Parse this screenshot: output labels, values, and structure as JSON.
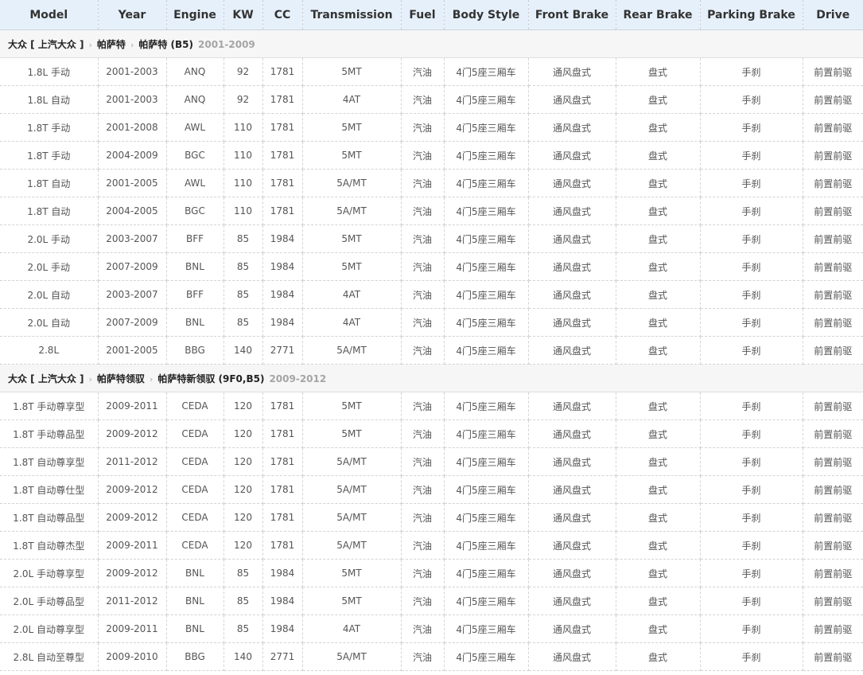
{
  "columns": [
    "Model",
    "Year",
    "Engine",
    "KW",
    "CC",
    "Transmission",
    "Fuel",
    "Body Style",
    "Front Brake",
    "Rear Brake",
    "Parking Brake",
    "Drive"
  ],
  "groups": [
    {
      "brand": "大众 [ 上汽大众 ]",
      "series": "帕萨特",
      "model": "帕萨特 (B5)",
      "years": "2001-2009",
      "rows": [
        [
          "1.8L 手动",
          "2001-2003",
          "ANQ",
          "92",
          "1781",
          "5MT",
          "汽油",
          "4门5座三厢车",
          "通风盘式",
          "盘式",
          "手刹",
          "前置前驱"
        ],
        [
          "1.8L 自动",
          "2001-2003",
          "ANQ",
          "92",
          "1781",
          "4AT",
          "汽油",
          "4门5座三厢车",
          "通风盘式",
          "盘式",
          "手刹",
          "前置前驱"
        ],
        [
          "1.8T 手动",
          "2001-2008",
          "AWL",
          "110",
          "1781",
          "5MT",
          "汽油",
          "4门5座三厢车",
          "通风盘式",
          "盘式",
          "手刹",
          "前置前驱"
        ],
        [
          "1.8T 手动",
          "2004-2009",
          "BGC",
          "110",
          "1781",
          "5MT",
          "汽油",
          "4门5座三厢车",
          "通风盘式",
          "盘式",
          "手刹",
          "前置前驱"
        ],
        [
          "1.8T 自动",
          "2001-2005",
          "AWL",
          "110",
          "1781",
          "5A/MT",
          "汽油",
          "4门5座三厢车",
          "通风盘式",
          "盘式",
          "手刹",
          "前置前驱"
        ],
        [
          "1.8T 自动",
          "2004-2005",
          "BGC",
          "110",
          "1781",
          "5A/MT",
          "汽油",
          "4门5座三厢车",
          "通风盘式",
          "盘式",
          "手刹",
          "前置前驱"
        ],
        [
          "2.0L 手动",
          "2003-2007",
          "BFF",
          "85",
          "1984",
          "5MT",
          "汽油",
          "4门5座三厢车",
          "通风盘式",
          "盘式",
          "手刹",
          "前置前驱"
        ],
        [
          "2.0L 手动",
          "2007-2009",
          "BNL",
          "85",
          "1984",
          "5MT",
          "汽油",
          "4门5座三厢车",
          "通风盘式",
          "盘式",
          "手刹",
          "前置前驱"
        ],
        [
          "2.0L 自动",
          "2003-2007",
          "BFF",
          "85",
          "1984",
          "4AT",
          "汽油",
          "4门5座三厢车",
          "通风盘式",
          "盘式",
          "手刹",
          "前置前驱"
        ],
        [
          "2.0L 自动",
          "2007-2009",
          "BNL",
          "85",
          "1984",
          "4AT",
          "汽油",
          "4门5座三厢车",
          "通风盘式",
          "盘式",
          "手刹",
          "前置前驱"
        ],
        [
          "2.8L",
          "2001-2005",
          "BBG",
          "140",
          "2771",
          "5A/MT",
          "汽油",
          "4门5座三厢车",
          "通风盘式",
          "盘式",
          "手刹",
          "前置前驱"
        ]
      ]
    },
    {
      "brand": "大众 [ 上汽大众 ]",
      "series": "帕萨特领驭",
      "model": "帕萨特新领驭 (9F0,B5)",
      "years": "2009-2012",
      "rows": [
        [
          "1.8T 手动尊享型",
          "2009-2011",
          "CEDA",
          "120",
          "1781",
          "5MT",
          "汽油",
          "4门5座三厢车",
          "通风盘式",
          "盘式",
          "手刹",
          "前置前驱"
        ],
        [
          "1.8T 手动尊品型",
          "2009-2012",
          "CEDA",
          "120",
          "1781",
          "5MT",
          "汽油",
          "4门5座三厢车",
          "通风盘式",
          "盘式",
          "手刹",
          "前置前驱"
        ],
        [
          "1.8T 自动尊享型",
          "2011-2012",
          "CEDA",
          "120",
          "1781",
          "5A/MT",
          "汽油",
          "4门5座三厢车",
          "通风盘式",
          "盘式",
          "手刹",
          "前置前驱"
        ],
        [
          "1.8T 自动尊仕型",
          "2009-2012",
          "CEDA",
          "120",
          "1781",
          "5A/MT",
          "汽油",
          "4门5座三厢车",
          "通风盘式",
          "盘式",
          "手刹",
          "前置前驱"
        ],
        [
          "1.8T 自动尊品型",
          "2009-2012",
          "CEDA",
          "120",
          "1781",
          "5A/MT",
          "汽油",
          "4门5座三厢车",
          "通风盘式",
          "盘式",
          "手刹",
          "前置前驱"
        ],
        [
          "1.8T 自动尊杰型",
          "2009-2011",
          "CEDA",
          "120",
          "1781",
          "5A/MT",
          "汽油",
          "4门5座三厢车",
          "通风盘式",
          "盘式",
          "手刹",
          "前置前驱"
        ],
        [
          "2.0L 手动尊享型",
          "2009-2012",
          "BNL",
          "85",
          "1984",
          "5MT",
          "汽油",
          "4门5座三厢车",
          "通风盘式",
          "盘式",
          "手刹",
          "前置前驱"
        ],
        [
          "2.0L 手动尊品型",
          "2011-2012",
          "BNL",
          "85",
          "1984",
          "5MT",
          "汽油",
          "4门5座三厢车",
          "通风盘式",
          "盘式",
          "手刹",
          "前置前驱"
        ],
        [
          "2.0L 自动尊享型",
          "2009-2011",
          "BNL",
          "85",
          "1984",
          "4AT",
          "汽油",
          "4门5座三厢车",
          "通风盘式",
          "盘式",
          "手刹",
          "前置前驱"
        ],
        [
          "2.8L 自动至尊型",
          "2009-2010",
          "BBG",
          "140",
          "2771",
          "5A/MT",
          "汽油",
          "4门5座三厢车",
          "通风盘式",
          "盘式",
          "手刹",
          "前置前驱"
        ]
      ]
    }
  ]
}
